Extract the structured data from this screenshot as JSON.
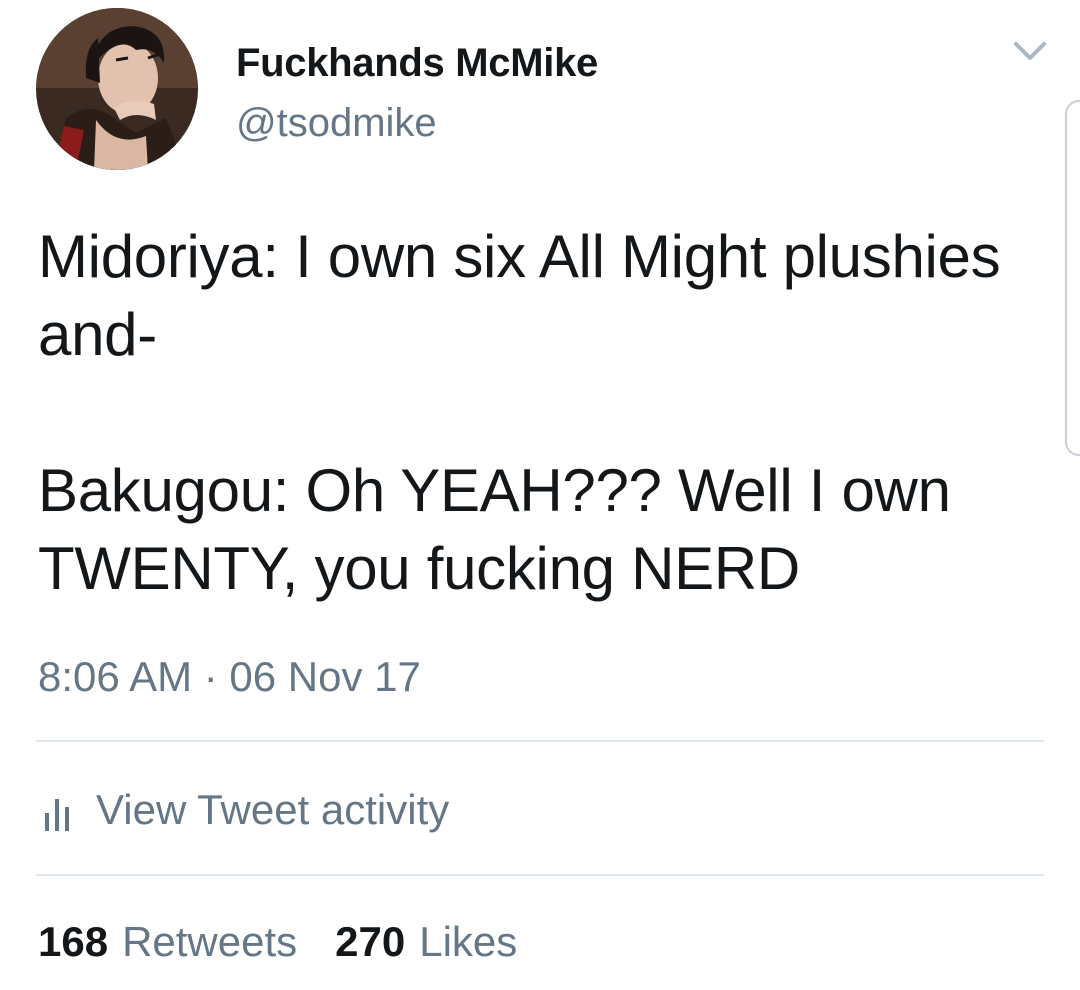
{
  "user": {
    "display_name": "Fuckhands McMike",
    "handle": "@tsodmike"
  },
  "tweet": {
    "paragraphs": [
      "Midoriya: I own six All Might plushies and-",
      "Bakugou: Oh YEAH??? Well I own TWENTY, you fucking NERD"
    ],
    "timestamp": "8:06 AM · 06 Nov 17"
  },
  "activity": {
    "label": "View Tweet activity",
    "icon": "bar-chart-icon"
  },
  "stats": {
    "retweets_count": "168",
    "retweets_label": "Retweets",
    "likes_count": "270",
    "likes_label": "Likes"
  },
  "icons": {
    "menu": "chevron-down-icon",
    "avatar": "avatar-illustration"
  },
  "colors": {
    "text": "#14171a",
    "secondary": "#657786",
    "divider": "#e1e8ed"
  }
}
